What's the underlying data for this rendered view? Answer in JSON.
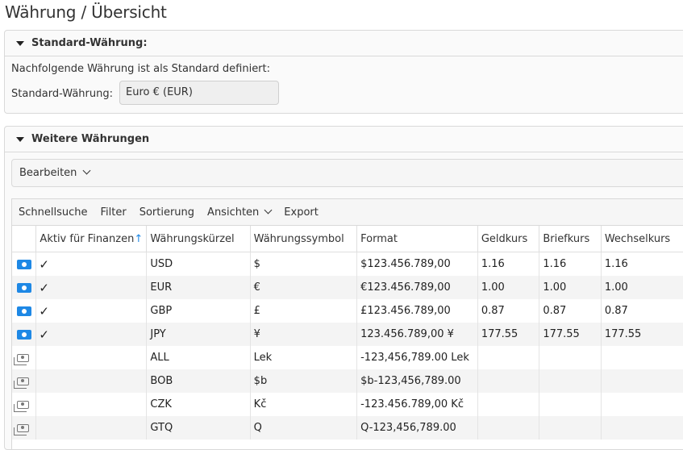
{
  "page": {
    "title": "Währung / Übersicht"
  },
  "standard": {
    "header": "Standard-Währung:",
    "info": "Nachfolgende Währung ist als Standard definiert:",
    "label": "Standard-Währung:",
    "value": "Euro € (EUR)"
  },
  "further": {
    "header": "Weitere Währungen",
    "edit_label": "Bearbeiten"
  },
  "toolbar": {
    "quicksearch": "Schnellsuche",
    "filter": "Filter",
    "sort": "Sortierung",
    "views": "Ansichten",
    "export": "Export"
  },
  "table": {
    "columns": [
      "Aktiv für Finanzen",
      "Währungskürzel",
      "Währungssymbol",
      "Format",
      "Geldkurs",
      "Briefkurs",
      "Wechselkurs"
    ],
    "sort_icon": "arrow-up-icon",
    "rows": [
      {
        "active": "✓",
        "icon": "currency-active-icon",
        "code": "USD",
        "symbol": "$",
        "format": "$123.456.789,00",
        "bid": "1.16",
        "ask": "1.16",
        "rate": "1.16"
      },
      {
        "active": "✓",
        "icon": "currency-active-icon",
        "code": "EUR",
        "symbol": "€",
        "format": "€123.456.789,00",
        "bid": "1.00",
        "ask": "1.00",
        "rate": "1.00"
      },
      {
        "active": "✓",
        "icon": "currency-active-icon",
        "code": "GBP",
        "symbol": "£",
        "format": "£123.456.789,00",
        "bid": "0.87",
        "ask": "0.87",
        "rate": "0.87"
      },
      {
        "active": "✓",
        "icon": "currency-active-icon",
        "code": "JPY",
        "symbol": "¥",
        "format": "123.456.789,00 ¥",
        "bid": "177.55",
        "ask": "177.55",
        "rate": "177.55"
      },
      {
        "active": "",
        "icon": "currency-inactive-icon",
        "code": "ALL",
        "symbol": "Lek",
        "format": "-123,456,789.00 Lek",
        "bid": "",
        "ask": "",
        "rate": ""
      },
      {
        "active": "",
        "icon": "currency-inactive-icon",
        "code": "BOB",
        "symbol": "$b",
        "format": "$b-123,456,789.00",
        "bid": "",
        "ask": "",
        "rate": ""
      },
      {
        "active": "",
        "icon": "currency-inactive-icon",
        "code": "CZK",
        "symbol": "Kč",
        "format": "-123.456.789,00 Kč",
        "bid": "",
        "ask": "",
        "rate": ""
      },
      {
        "active": "",
        "icon": "currency-inactive-icon",
        "code": "GTQ",
        "symbol": "Q",
        "format": "Q-123,456,789.00",
        "bid": "",
        "ask": "",
        "rate": ""
      }
    ]
  },
  "colors": {
    "accent": "#1e88e5",
    "row_alt": "#f4f4f4"
  }
}
